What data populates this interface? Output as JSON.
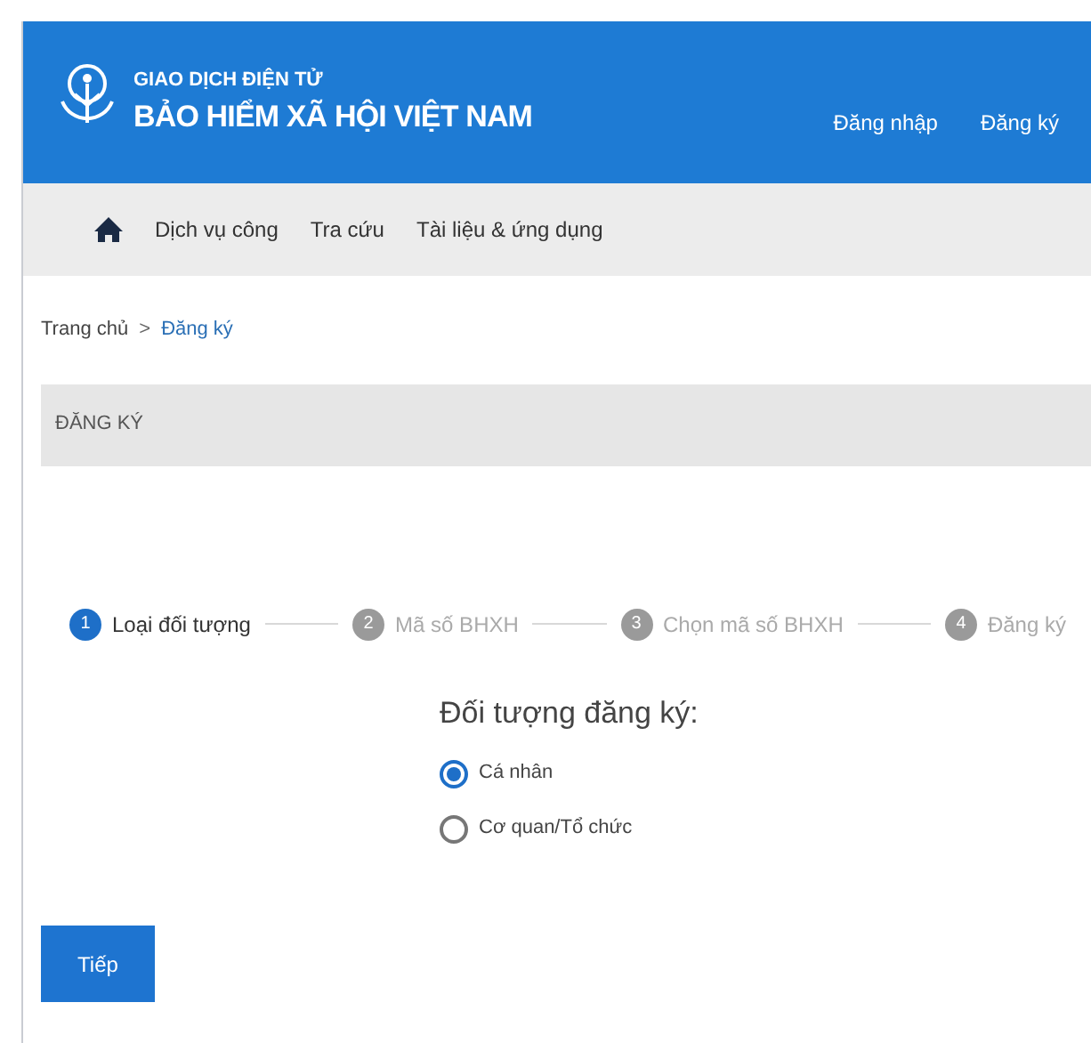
{
  "header": {
    "subtitle": "GIAO DỊCH ĐIỆN TỬ",
    "title": "BẢO HIỂM XÃ HỘI VIỆT NAM",
    "links": [
      "Đăng nhập",
      "Đăng ký"
    ]
  },
  "nav": {
    "items": [
      "Dịch vụ công",
      "Tra cứu",
      "Tài liệu & ứng dụng"
    ]
  },
  "breadcrumb": [
    {
      "label": "Trang chủ",
      "selected": false
    },
    {
      "label": "Đăng ký",
      "selected": true
    }
  ],
  "breadcrumb_separator": ">",
  "section_title": "ĐĂNG KÝ",
  "steps": [
    {
      "number": "1",
      "label": "Loại đối tượng",
      "selected": true
    },
    {
      "number": "2",
      "label": "Mã số BHXH",
      "selected": false
    },
    {
      "number": "3",
      "label": "Chọn mã số BHXH",
      "selected": false
    },
    {
      "number": "4",
      "label": "Đăng ký",
      "selected": false
    }
  ],
  "question": "Đối tượng đăng ký:",
  "options": [
    {
      "label": "Cá nhân",
      "selected": true
    },
    {
      "label": "Cơ quan/Tổ chức",
      "selected": false
    }
  ],
  "next_button": "Tiếp"
}
